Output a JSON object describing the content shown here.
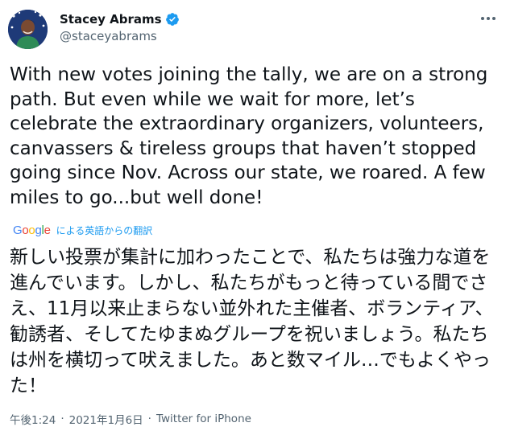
{
  "author": {
    "display_name": "Stacey Abrams",
    "handle": "@staceyabrams",
    "verified": true
  },
  "tweet": {
    "text": "With new votes joining the tally, we are on a strong path. But even while we wait for more, let’s celebrate the extraordinary organizers, volunteers, canvassers & tireless groups that haven’t stopped going since Nov. Across our state, we roared. A few miles to go...but well done!"
  },
  "translation": {
    "provider": "Google",
    "label": "による英語からの翻訳",
    "text": "新しい投票が集計に加わったことで、私たちは強力な道を進んでいます。しかし、私たちがもっと待っている間でさえ、11月以来止まらない並外れた主催者、ボランティア、勧誘者、そしてたゆまぬグループを祝いましょう。私たちは州を横切って吠えました。あと数マイル…でもよくやった！"
  },
  "meta": {
    "time": "午後1:24",
    "date": "2021年1月6日",
    "source": "Twitter for iPhone",
    "separator": "·"
  },
  "icons": {
    "verified": "verified-badge-icon",
    "more": "more-options-icon"
  },
  "colors": {
    "text": "#0f1419",
    "secondary": "#536471",
    "link": "#1d9bf0",
    "verified": "#1d9bf0"
  }
}
